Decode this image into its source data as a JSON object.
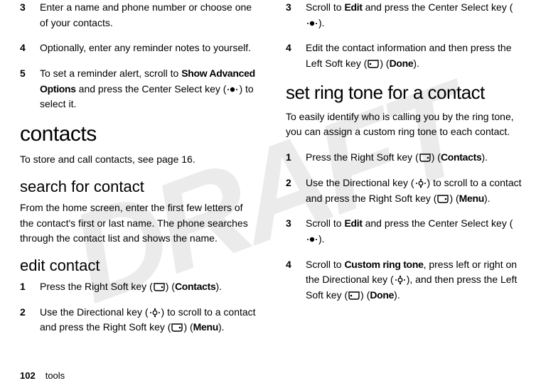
{
  "watermark": "DRAFT",
  "left": {
    "step3": {
      "n": "3",
      "text_a": "Enter a name and phone number or choose one of your contacts."
    },
    "step4": {
      "n": "4",
      "text_a": "Optionally, enter any reminder notes to yourself."
    },
    "step5": {
      "n": "5",
      "text_a": "To set a reminder alert, scroll to ",
      "bold1": "Show Advanced Options",
      "text_b": " and press the Center Select key (",
      "text_c": ") to select it."
    },
    "h1": "contacts",
    "intro": "To store and call contacts, see page 16.",
    "h2a": "search for contact",
    "search_p": "From the home screen, enter the first few letters of the contact's first or last name. The phone searches through the contact list and shows the name.",
    "h2b": "edit contact",
    "edit1": {
      "n": "1",
      "a": "Press the Right Soft key (",
      "b": ") (",
      "label": "Contacts",
      "c": ")."
    },
    "edit2": {
      "n": "2",
      "a": "Use the Directional key (",
      "b": ") to scroll to a contact and press the Right Soft key (",
      "c": ") (",
      "label": "Menu",
      "d": ")."
    }
  },
  "right": {
    "step3": {
      "n": "3",
      "a": "Scroll to ",
      "bold": "Edit",
      "b": " and press the Center Select key (",
      "c": ")."
    },
    "step4": {
      "n": "4",
      "a": "Edit the contact information and then press the Left Soft key (",
      "b": ") (",
      "label": "Done",
      "c": ")."
    },
    "h1": "set ring tone for a contact",
    "intro": "To easily identify who is calling you by the ring tone, you can assign a custom ring tone to each contact.",
    "r1": {
      "n": "1",
      "a": "Press the Right Soft key (",
      "b": ") (",
      "label": "Contacts",
      "c": ")."
    },
    "r2": {
      "n": "2",
      "a": "Use the Directional key (",
      "b": ") to scroll to a contact and press the Right Soft key (",
      "c": ") (",
      "label": "Menu",
      "d": ")."
    },
    "r3": {
      "n": "3",
      "a": "Scroll to ",
      "bold": "Edit",
      "b": " and press the Center Select key (",
      "c": ")."
    },
    "r4": {
      "n": "4",
      "a": "Scroll to ",
      "bold": "Custom ring tone",
      "b": ", press left or right on the Directional key (",
      "c": "), and then press the Left Soft key (",
      "d": ") (",
      "label": "Done",
      "e": ")."
    }
  },
  "footer": {
    "page": "102",
    "section": "tools"
  }
}
